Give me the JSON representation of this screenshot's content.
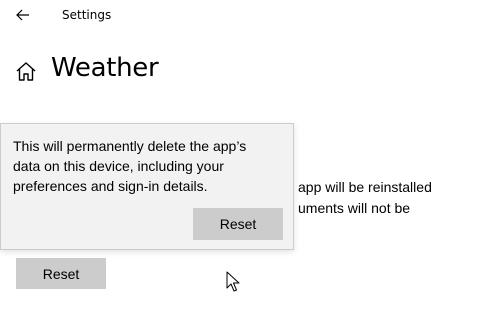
{
  "header": {
    "back_icon": "back-arrow-icon",
    "app_title": "Settings"
  },
  "page": {
    "home_icon": "home-icon",
    "title": "Weather"
  },
  "background_text": {
    "line1": "app will be reinstalled",
    "line2": "uments will not be"
  },
  "background_reset_label": "Reset",
  "flyout": {
    "message_line1": "This will permanently delete the app’s",
    "message_line2": "data on this device, including your",
    "message_line3": "preferences and sign-in details.",
    "confirm_label": "Reset"
  },
  "colors": {
    "button_bg": "#cccccc",
    "flyout_bg": "#f2f2f2",
    "flyout_border": "#cccccc"
  },
  "pointer": "mouse-pointer-icon"
}
